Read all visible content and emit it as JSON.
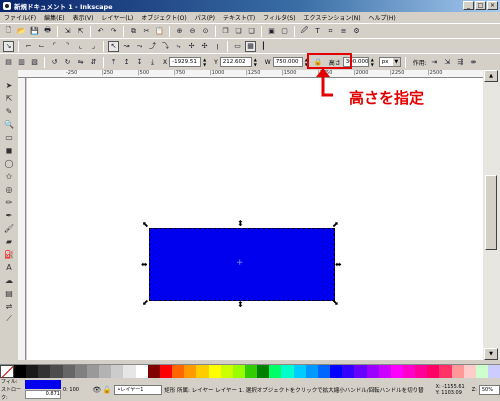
{
  "window": {
    "title": "新規ドキュメント 1 - Inkscape",
    "min": "_",
    "max": "□",
    "close": "×"
  },
  "menu": [
    "ファイル(F)",
    "編集(E)",
    "表示(V)",
    "レイヤー(L)",
    "オブジェクト(O)",
    "パス(P)",
    "テキスト(T)",
    "フィルタ(S)",
    "エクステンション(N)",
    "ヘルプ(H)"
  ],
  "controls": {
    "x_label": "X",
    "x_value": "-1929.51",
    "y_label": "Y",
    "y_value": "212.602",
    "w_label": "W",
    "w_value": "750.000",
    "h_label": "高さ",
    "h_value": "300.000",
    "unit": "px",
    "affect_label": "作用:"
  },
  "ruler": {
    "marks": [
      "-250",
      "|250",
      "|500",
      "|750",
      "|1000",
      "|1250",
      "|1500",
      "|1750",
      "|2000",
      "|2250",
      "|2500"
    ]
  },
  "annotation": {
    "text": "高さを指定",
    "color": "#e30000"
  },
  "canvas": {
    "rect_color": "#0000ee"
  },
  "palette": [
    "#000000",
    "#1a1a1a",
    "#333333",
    "#4d4d4d",
    "#666666",
    "#808080",
    "#999999",
    "#b3b3b3",
    "#cccccc",
    "#e6e6e6",
    "#ffffff",
    "#800000",
    "#ff0000",
    "#ff6600",
    "#ff9900",
    "#ffcc00",
    "#ffff00",
    "#ccff00",
    "#99ff00",
    "#33cc00",
    "#008000",
    "#00ff66",
    "#00ffcc",
    "#00ccff",
    "#0099ff",
    "#0066ff",
    "#0000ff",
    "#3300ff",
    "#6600ff",
    "#9900ff",
    "#cc00ff",
    "#ff00ff",
    "#ff00cc",
    "#ff0099",
    "#ff0066",
    "#ff3366",
    "#ff9999",
    "#ffcccc",
    "#ccffcc",
    "#ccccff"
  ],
  "status": {
    "fill_label": "フィル:",
    "stroke_label": "ストローク:",
    "stroke_width": "0.871",
    "opacity": "0: 100",
    "layer": "•レイヤー1",
    "message": "矩形 所属: レイヤー レイヤー 1. 選択オブジェクトをクリックで拡大縮小ハンドル/回転ハンドルを切り替",
    "x": "X: -1155.61",
    "y": "Y: 1103.09",
    "zoom_label": "Z:",
    "zoom": "50%"
  }
}
